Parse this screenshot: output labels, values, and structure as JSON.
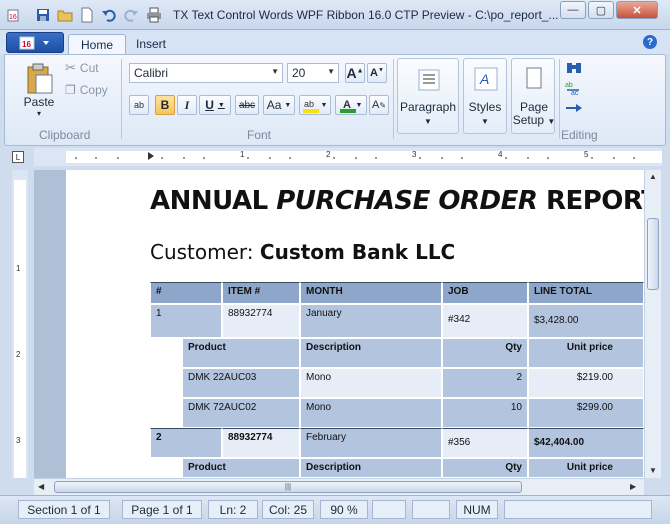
{
  "window": {
    "title": "TX Text Control Words WPF Ribbon 16.0 CTP Preview - C:\\po_report_...",
    "minimize": "—",
    "maximize": "▢",
    "close": "✕"
  },
  "tabs": [
    {
      "label": "Home",
      "active": true
    },
    {
      "label": "Insert",
      "active": false
    }
  ],
  "ribbon": {
    "clipboard": {
      "group_label": "Clipboard",
      "paste": "Paste",
      "cut": "Cut",
      "copy": "Copy"
    },
    "font": {
      "group_label": "Font",
      "family": "Calibri",
      "size": "20",
      "bold": "B",
      "italic": "I",
      "underline": "U",
      "strike": "abc",
      "case": "Aa"
    },
    "paragraph": {
      "label": "Paragraph"
    },
    "styles": {
      "label": "Styles"
    },
    "page_setup": {
      "label": "Page Setup"
    },
    "editing": {
      "group_label": "Editing"
    }
  },
  "ruler": {
    "h_numbers": [
      "1",
      "2",
      "3",
      "4",
      "5"
    ],
    "v_numbers": [
      "1",
      "2",
      "3"
    ]
  },
  "document": {
    "title_part1": "ANNUAL ",
    "title_part2": "PURCHASE ORDER",
    "title_part3": " REPORT",
    "customer_label": "Customer: ",
    "customer_name": "Custom Bank LLC",
    "table": {
      "headers": [
        "#",
        "ITEM #",
        "MONTH",
        "JOB",
        "LINE TOTAL"
      ],
      "orders": [
        {
          "num": "1",
          "item": "88932774",
          "month": "January",
          "job": "#342",
          "total": "$3,428.00",
          "sub_headers": [
            "Product",
            "Description",
            "Qty",
            "Unit price"
          ],
          "lines": [
            {
              "product": "DMK 22AUC03",
              "description": "Mono",
              "qty": "2",
              "price": "$219.00"
            },
            {
              "product": "DMK 72AUC02",
              "description": "Mono",
              "qty": "10",
              "price": "$299.00"
            }
          ]
        },
        {
          "num": "2",
          "item": "88932774",
          "month": "February",
          "job": "#356",
          "total": "$42,404.00",
          "sub_headers": [
            "Product",
            "Description",
            "Qty",
            "Unit price"
          ]
        }
      ]
    }
  },
  "statusbar": {
    "section": "Section 1 of 1",
    "page": "Page 1 of 1",
    "line": "Ln: 2",
    "col": "Col: 25",
    "zoom": "90 %",
    "num": "NUM"
  },
  "colors": {
    "header_row": "#8ea6c9",
    "cell_blue": "#b2c4de",
    "cell_light": "#e6edf7",
    "app_button": "#1d4fa3"
  }
}
